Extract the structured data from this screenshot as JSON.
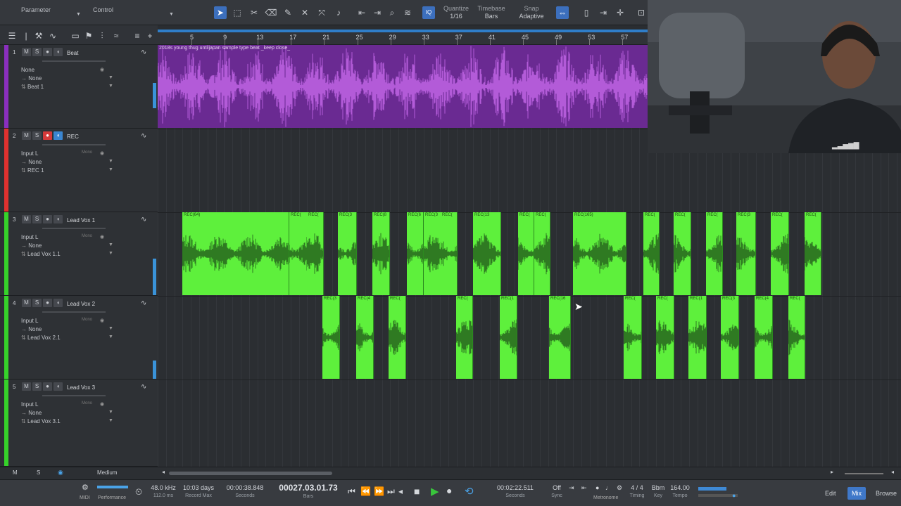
{
  "toolbar": {
    "parameter_label": "Parameter",
    "control_label": "Control",
    "quantize_label": "Quantize",
    "quantize_value": "1/16",
    "timebase_label": "Timebase",
    "timebase_value": "Bars",
    "snap_label": "Snap",
    "snap_value": "Adaptive",
    "iq_label": "IQ"
  },
  "ruler": {
    "bars": [
      "5",
      "9",
      "13",
      "17",
      "21",
      "25",
      "29",
      "33",
      "37",
      "41",
      "45",
      "49",
      "53",
      "57"
    ]
  },
  "tracks": [
    {
      "num": "1",
      "name": "Beat",
      "color": "#8a2fbf",
      "row1": "None",
      "row2": "None",
      "row3": "Beat 1",
      "mute": "M",
      "solo": "S"
    },
    {
      "num": "2",
      "name": "REC",
      "color": "#e0312f",
      "row1": "Input L",
      "row1_tag": "Mono",
      "row2": "None",
      "row3": "REC 1",
      "mute": "M",
      "solo": "S"
    },
    {
      "num": "3",
      "name": "Lead Vox 1",
      "color": "#36d22a",
      "row1": "Input L",
      "row1_tag": "Mono",
      "row2": "None",
      "row3": "Lead Vox 1.1",
      "mute": "M",
      "solo": "S"
    },
    {
      "num": "4",
      "name": "Lead Vox 2",
      "color": "#36d22a",
      "row1": "Input L",
      "row1_tag": "Mono",
      "row2": "None",
      "row3": "Lead Vox 2.1",
      "mute": "M",
      "solo": "S"
    },
    {
      "num": "5",
      "name": "Lead Vox 3",
      "color": "#36d22a",
      "row1": "Input L",
      "row1_tag": "Mono",
      "row2": "None",
      "row3": "Lead Vox 3.1",
      "mute": "M",
      "solo": "S"
    }
  ],
  "beat_clip_label": "2018s young thug  untiljapan sample type beat _keep close_",
  "clips": {
    "lane3_labels": [
      "REC(64)",
      "REC(",
      "REC(",
      "REC(3",
      "REC(8",
      "REC(6",
      "REC(3",
      "REC(",
      "REC(13",
      "REC(",
      "REC(",
      "REC(165)",
      "REC(",
      "REC(",
      "REC(",
      "REC(3",
      "REC(",
      "REC("
    ],
    "lane4_labels": [
      "REC(3",
      "REC(4",
      "REC(",
      "REC(",
      "REC(1",
      "REC(16",
      "REC(",
      "REC(",
      "REC(1",
      "REC(3",
      "REC(4",
      "REC("
    ]
  },
  "footer_left": {
    "m_label": "M",
    "s_label": "S",
    "zoom_label": "Medium"
  },
  "transport": {
    "midi_label": "MIDI",
    "performance_label": "Performance",
    "sample_rate": "48.0 kHz",
    "latency": "112.0 ms",
    "record_days": "10:03 days",
    "record_max_label": "Record Max",
    "seconds_time": "00:00:38.848",
    "seconds_label": "Seconds",
    "bars_time": "00027.03.01.73",
    "bars_label": "Bars",
    "loop_time": "00:02:22.511",
    "loop_seconds_label": "Seconds",
    "sync_value": "Off",
    "sync_label": "Sync",
    "metronome_label": "Metronome",
    "timing_value": "4 / 4",
    "timing_label": "Timing",
    "key_value": "Bbm",
    "key_label": "Key",
    "tempo_value": "164.00",
    "tempo_label": "Tempo",
    "edit_label": "Edit",
    "mix_label": "Mix",
    "browse_label": "Browse"
  }
}
